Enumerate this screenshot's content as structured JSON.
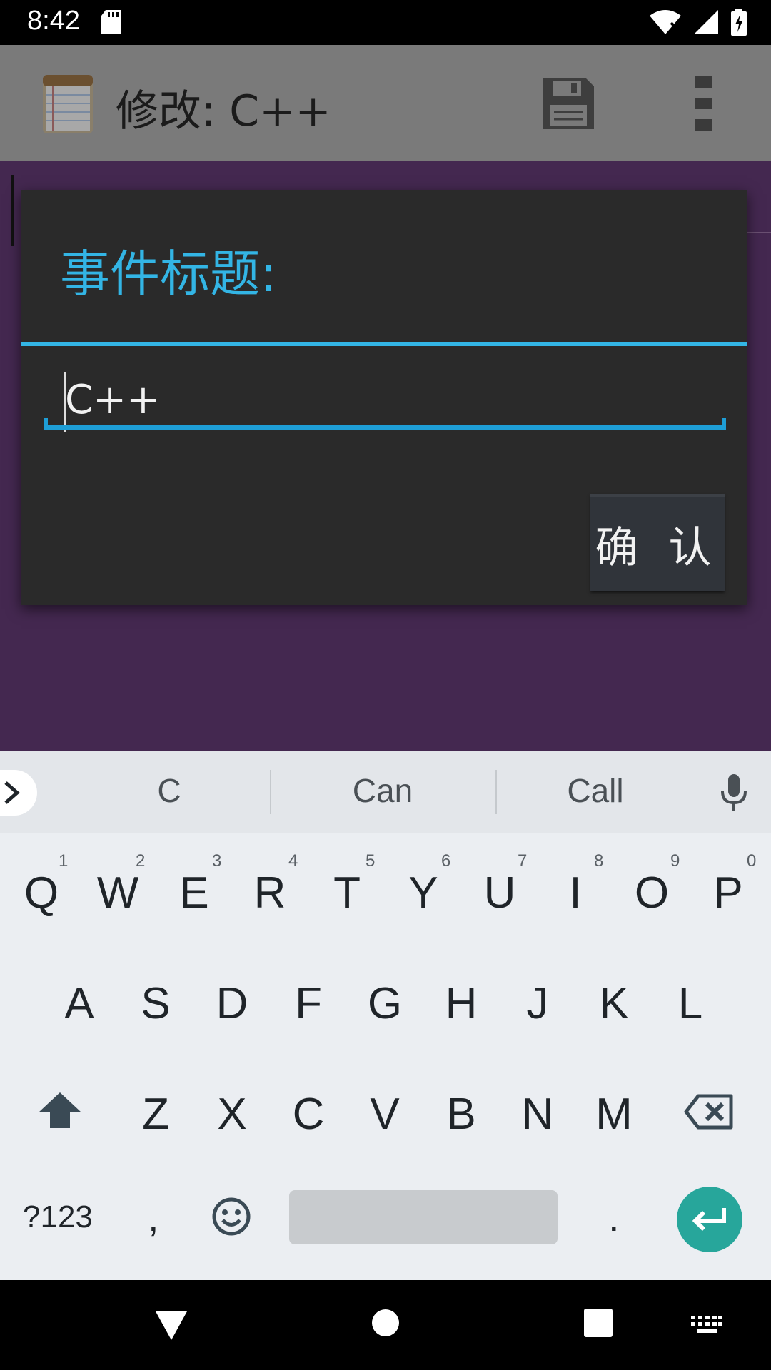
{
  "status_bar": {
    "time": "8:42",
    "icons": [
      "sd-card-icon",
      "wifi-icon",
      "cell-signal-icon",
      "battery-charging-icon"
    ]
  },
  "app_bar": {
    "title": "修改: C++",
    "icons": [
      "notepad-app-icon",
      "save-icon",
      "overflow-menu-icon"
    ]
  },
  "dialog": {
    "title": "事件标题:",
    "input_value": "C++",
    "confirm_label": "确 认"
  },
  "keyboard": {
    "suggestions": [
      "C",
      "Can",
      "Call"
    ],
    "row1": [
      {
        "key": "Q",
        "hint": "1"
      },
      {
        "key": "W",
        "hint": "2"
      },
      {
        "key": "E",
        "hint": "3"
      },
      {
        "key": "R",
        "hint": "4"
      },
      {
        "key": "T",
        "hint": "5"
      },
      {
        "key": "Y",
        "hint": "6"
      },
      {
        "key": "U",
        "hint": "7"
      },
      {
        "key": "I",
        "hint": "8"
      },
      {
        "key": "O",
        "hint": "9"
      },
      {
        "key": "P",
        "hint": "0"
      }
    ],
    "row2": [
      "A",
      "S",
      "D",
      "F",
      "G",
      "H",
      "J",
      "K",
      "L"
    ],
    "row3": [
      "Z",
      "X",
      "C",
      "V",
      "B",
      "N",
      "M"
    ],
    "symbols_label": "?123",
    "comma_label": ",",
    "period_label": "."
  },
  "colors": {
    "accent": "#33b5e5",
    "input_underline": "#1e9ed6",
    "content_background": "#442850",
    "enter_key": "#27a69b"
  }
}
